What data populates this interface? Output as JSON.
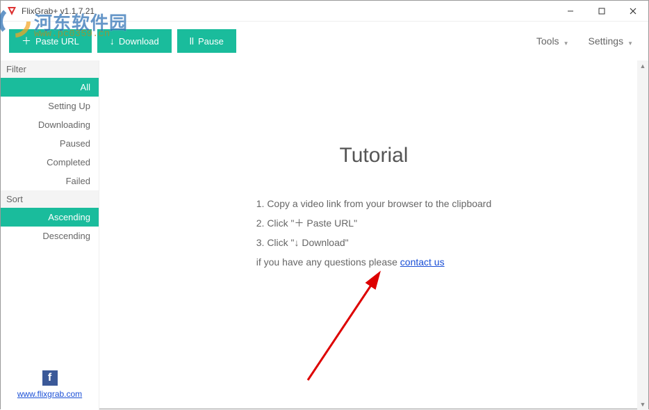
{
  "titlebar": {
    "title": "FlixGrab+ v1.1.7.21"
  },
  "toolbar": {
    "paste_label": "Paste URL",
    "download_label": "Download",
    "pause_label": "Pause",
    "tools_label": "Tools",
    "settings_label": "Settings"
  },
  "sidebar": {
    "filter_header": "Filter",
    "filter_items": [
      "All",
      "Setting Up",
      "Downloading",
      "Paused",
      "Completed",
      "Failed"
    ],
    "filter_selected_index": 0,
    "sort_header": "Sort",
    "sort_items": [
      "Ascending",
      "Descending"
    ],
    "sort_selected_index": 0,
    "site_url": "www.flixgrab.com"
  },
  "tutorial": {
    "heading": "Tutorial",
    "step1": "1. Copy a video link from your browser to the clipboard",
    "step2": "2. Click \"＋ Paste URL\"",
    "step3": "3. Click \"↓ Download\"",
    "help_prefix": "if you have any questions please ",
    "help_link": "contact us"
  },
  "watermark": {
    "text": "河东软件园",
    "sub": "www.pc0359.cn"
  },
  "colors": {
    "accent": "#1abc9c",
    "link": "#1a4fd6"
  }
}
